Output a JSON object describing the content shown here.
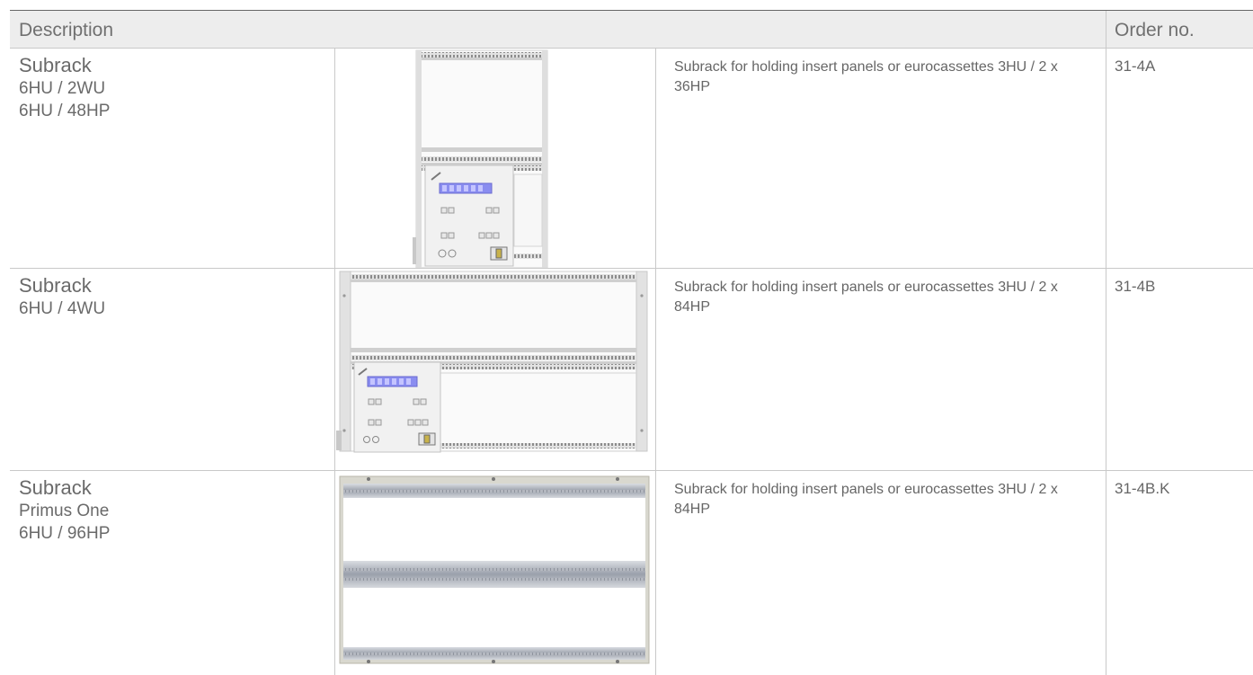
{
  "table": {
    "header": {
      "description": "Description",
      "order_no": "Order no."
    },
    "rows": [
      {
        "name": "Subrack",
        "specs": [
          "6HU / 2WU",
          "6HU / 48HP"
        ],
        "text": "Subrack for holding insert panels or eurocassettes 3HU / 2 x 36HP",
        "order_no": "31-4A",
        "image": "subrack-narrow-with-control-panel-image"
      },
      {
        "name": "Subrack",
        "specs": [
          "6HU / 4WU"
        ],
        "text": "Subrack for holding insert panels or eurocassettes 3HU / 2 x 84HP",
        "order_no": "31-4B",
        "image": "subrack-wide-with-control-panel-image"
      },
      {
        "name": "Subrack",
        "specs": [
          "Primus One",
          "6HU / 96HP"
        ],
        "text": "Subrack for holding insert panels or eurocassettes 3HU / 2 x 84HP",
        "order_no": "31-4B.K",
        "image": "subrack-primus-one-image"
      }
    ]
  },
  "colors": {
    "header_bg": "#ededed",
    "rule": "#c9c9c9",
    "text": "#666666",
    "display_blue": "#8a8df0"
  }
}
